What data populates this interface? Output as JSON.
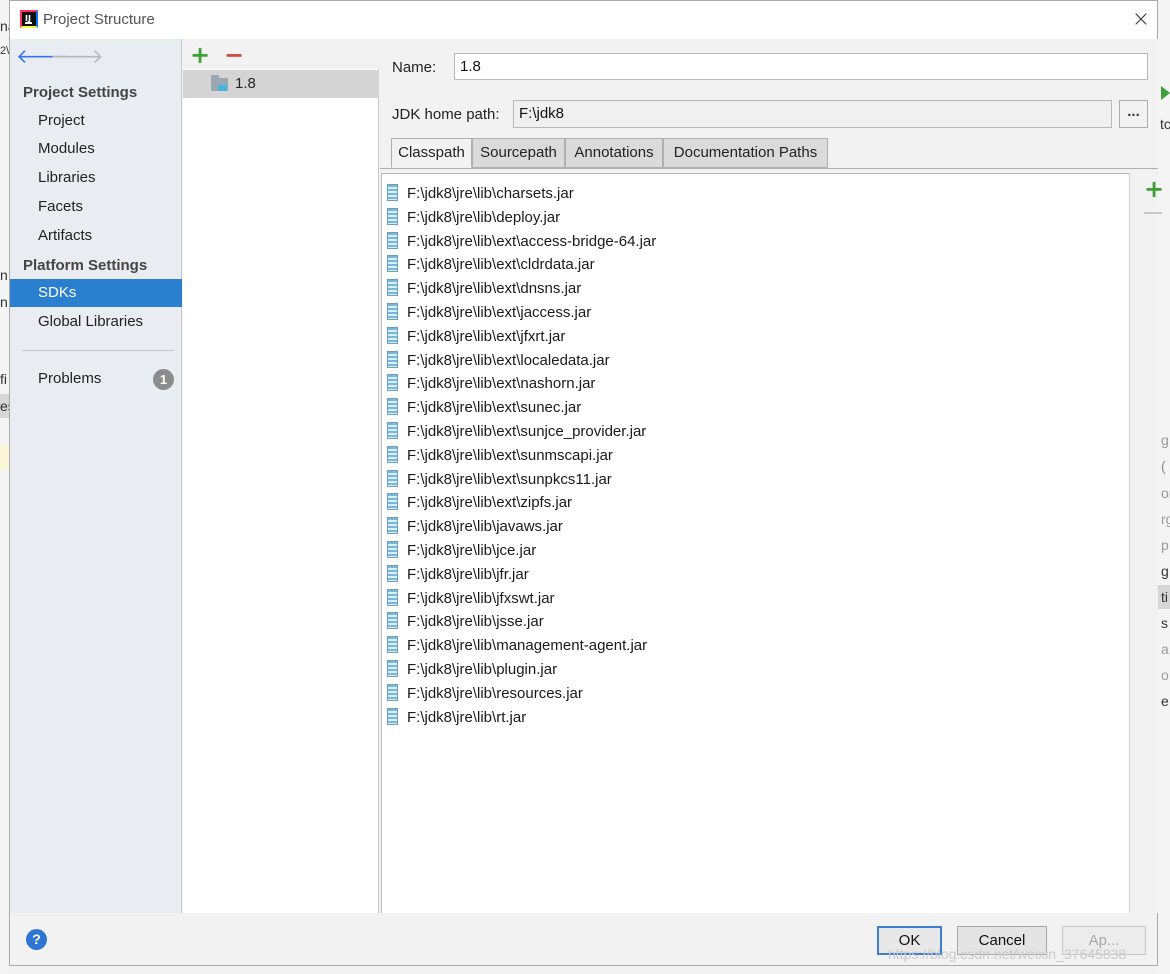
{
  "window": {
    "title": "Project Structure",
    "close_glyph": "×"
  },
  "nav": {
    "project_settings_header": "Project Settings",
    "project_items": [
      "Project",
      "Modules",
      "Libraries",
      "Facets",
      "Artifacts"
    ],
    "platform_settings_header": "Platform Settings",
    "platform_items": [
      "SDKs",
      "Global Libraries"
    ],
    "selected_item": "SDKs",
    "problems_label": "Problems",
    "problems_count": "1"
  },
  "sdk_list": {
    "items": [
      "1.8"
    ],
    "add_glyph": "+",
    "remove_glyph": "−"
  },
  "sdk": {
    "name_label": "Name:",
    "name_value": "1.8",
    "home_label": "JDK home path:",
    "home_value": "F:\\jdk8",
    "browse_label": "..."
  },
  "tabs": [
    "Classpath",
    "Sourcepath",
    "Annotations",
    "Documentation Paths"
  ],
  "active_tab": "Classpath",
  "classpath": [
    "F:\\jdk8\\jre\\lib\\charsets.jar",
    "F:\\jdk8\\jre\\lib\\deploy.jar",
    "F:\\jdk8\\jre\\lib\\ext\\access-bridge-64.jar",
    "F:\\jdk8\\jre\\lib\\ext\\cldrdata.jar",
    "F:\\jdk8\\jre\\lib\\ext\\dnsns.jar",
    "F:\\jdk8\\jre\\lib\\ext\\jaccess.jar",
    "F:\\jdk8\\jre\\lib\\ext\\jfxrt.jar",
    "F:\\jdk8\\jre\\lib\\ext\\localedata.jar",
    "F:\\jdk8\\jre\\lib\\ext\\nashorn.jar",
    "F:\\jdk8\\jre\\lib\\ext\\sunec.jar",
    "F:\\jdk8\\jre\\lib\\ext\\sunjce_provider.jar",
    "F:\\jdk8\\jre\\lib\\ext\\sunmscapi.jar",
    "F:\\jdk8\\jre\\lib\\ext\\sunpkcs11.jar",
    "F:\\jdk8\\jre\\lib\\ext\\zipfs.jar",
    "F:\\jdk8\\jre\\lib\\javaws.jar",
    "F:\\jdk8\\jre\\lib\\jce.jar",
    "F:\\jdk8\\jre\\lib\\jfr.jar",
    "F:\\jdk8\\jre\\lib\\jfxswt.jar",
    "F:\\jdk8\\jre\\lib\\jsse.jar",
    "F:\\jdk8\\jre\\lib\\management-agent.jar",
    "F:\\jdk8\\jre\\lib\\plugin.jar",
    "F:\\jdk8\\jre\\lib\\resources.jar",
    "F:\\jdk8\\jre\\lib\\rt.jar"
  ],
  "classpath_add_glyph": "+",
  "footer": {
    "help_glyph": "?",
    "ok_label": "OK",
    "cancel_label": "Cancel",
    "apply_label": "Ap..."
  },
  "watermark": "https://blog.csdn.net/weixin_37645838",
  "background_fragments": {
    "left": [
      "na",
      "2\\",
      "n",
      "n",
      "fi",
      "es"
    ],
    "right": [
      "g",
      "(",
      "or",
      "rg",
      "p",
      "g",
      "ti",
      "s",
      "a",
      "o",
      "e",
      "tc"
    ]
  },
  "colors": {
    "accent": "#2a7fcf",
    "add_green": "#3d9f38",
    "remove_red": "#d04a3f"
  }
}
